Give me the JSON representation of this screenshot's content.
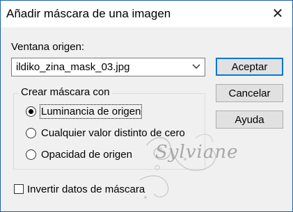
{
  "window": {
    "title": "Añadir máscara de una imagen"
  },
  "source": {
    "label": "Ventana origen:",
    "selected": "ildiko_zina_mask_03.jpg"
  },
  "buttons": {
    "accept": "Aceptar",
    "cancel": "Cancelar",
    "help": "Ayuda"
  },
  "mask_group": {
    "title": "Crear máscara con",
    "options": [
      {
        "label": "Luminancia de origen",
        "checked": true
      },
      {
        "label": "Cualquier valor distinto de cero",
        "checked": false
      },
      {
        "label": "Opacidad de origen",
        "checked": false
      }
    ]
  },
  "invert": {
    "label": "Invertir datos de máscara",
    "checked": false
  },
  "watermark": {
    "text": "Sylviane"
  },
  "icons": {
    "close": "close-icon",
    "dropdown": "chevron-down-icon"
  }
}
